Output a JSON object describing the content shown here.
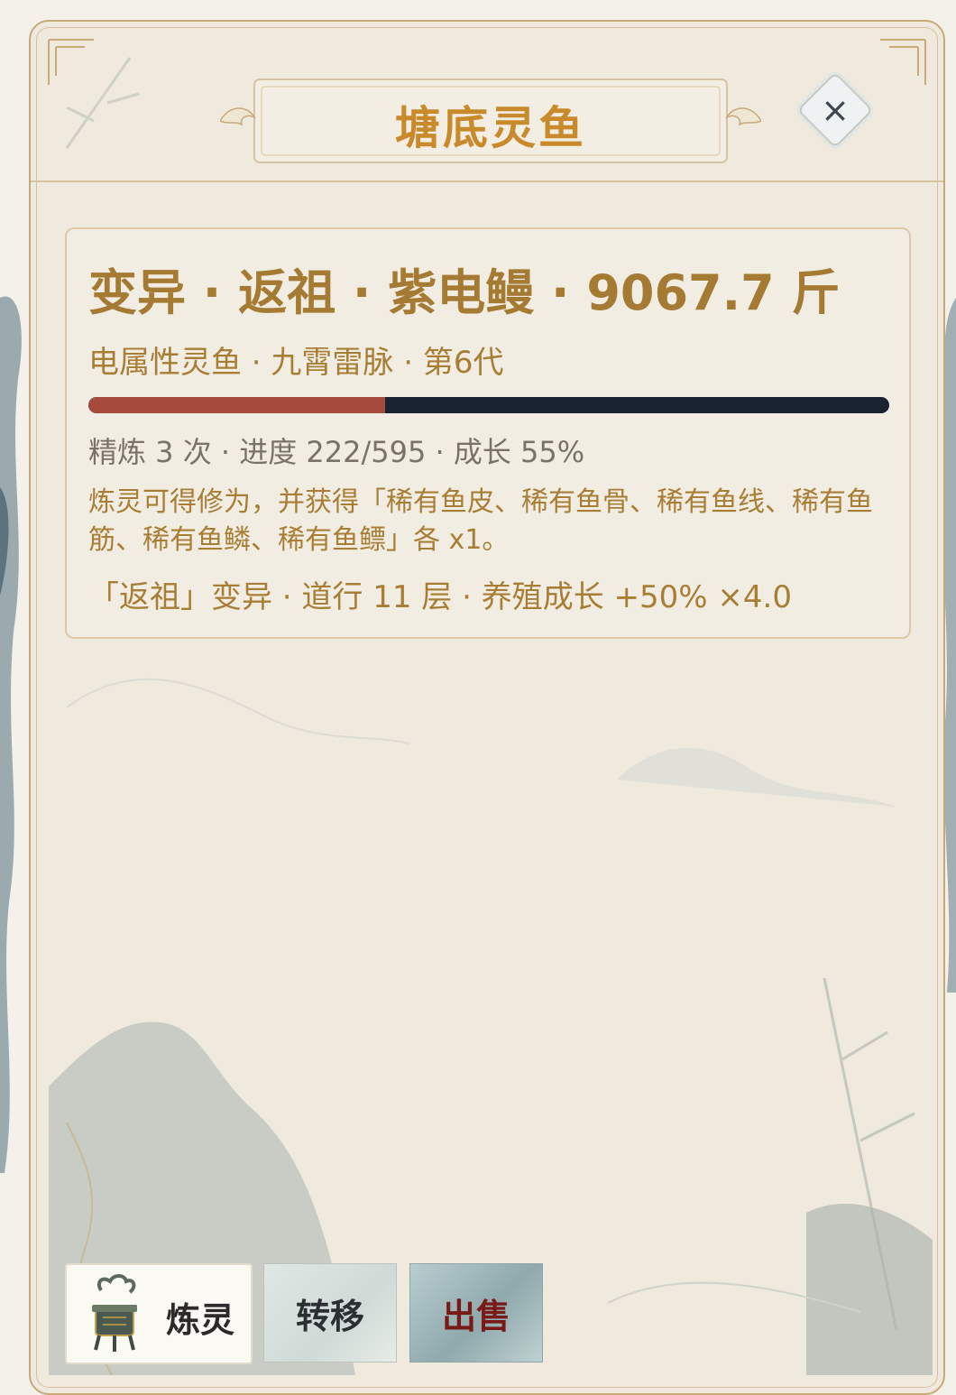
{
  "dialog": {
    "title": "塘底灵鱼",
    "close_symbol": "×"
  },
  "fish": {
    "headline": "变异 · 返祖 · 紫电鳗 · 9067.7 斤",
    "subline": "电属性灵鱼 · 九霄雷脉 · 第6代",
    "progress": 0.37,
    "stats": "精炼 3 次 · 进度 222/595 · 成长 55%",
    "description": "炼灵可得修为，并获得「稀有鱼皮、稀有鱼骨、稀有鱼线、稀有鱼筋、稀有鱼鳞、稀有鱼鳔」各 x1。",
    "mutation": "「返祖」变异 · 道行 11 层 · 养殖成长 +50% ×4.0"
  },
  "actions": {
    "refine_label": "炼灵",
    "refine_icon": "bronze-cauldron-icon",
    "transfer_label": "转移",
    "sell_label": "出售"
  },
  "colors": {
    "accent_gold": "#c98a2b",
    "text_brown": "#a87d34",
    "progress_fill": "#a64b3c",
    "progress_track": "#1a2332",
    "sell_red": "#7a1a16"
  }
}
